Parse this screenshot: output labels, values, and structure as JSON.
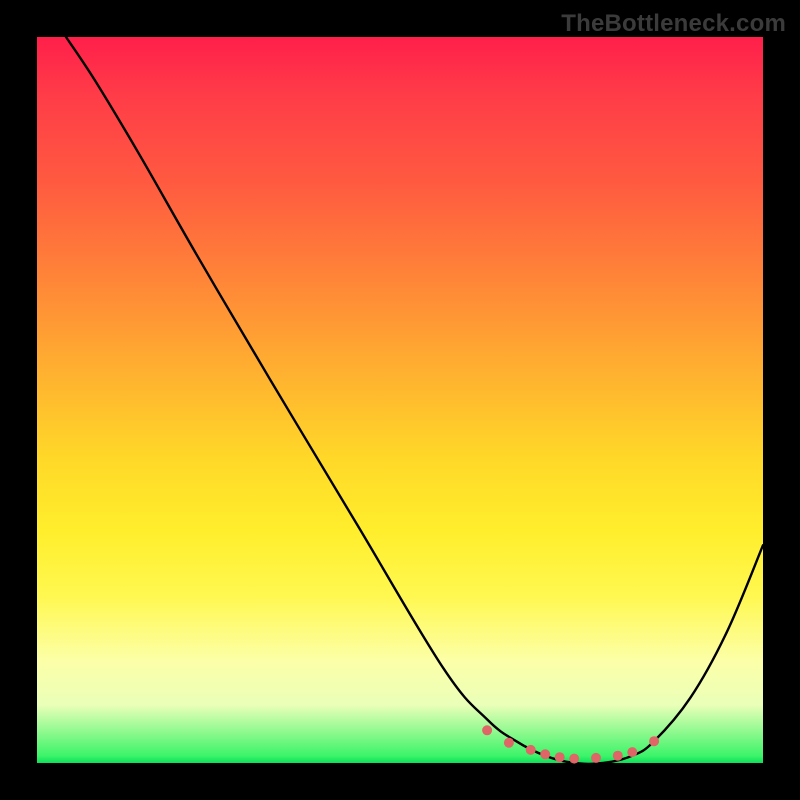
{
  "watermark": "TheBottleneck.com",
  "chart_data": {
    "type": "line",
    "title": "",
    "xlabel": "",
    "ylabel": "",
    "xlim": [
      0,
      100
    ],
    "ylim": [
      0,
      100
    ],
    "grid": false,
    "legend": false,
    "background_gradient": {
      "top": "#ff1f4a",
      "middle": "#ffee2c",
      "bottom": "#0ae058"
    },
    "series": [
      {
        "name": "bottleneck-curve",
        "x": [
          4,
          8,
          14,
          22,
          32,
          44,
          56,
          62,
          66,
          70,
          74,
          78,
          82,
          85,
          90,
          95,
          100
        ],
        "y": [
          100,
          94,
          84,
          70,
          53,
          33,
          13,
          6,
          3,
          1,
          0,
          0,
          1,
          3,
          9,
          18,
          30
        ]
      }
    ],
    "markers": {
      "name": "min-zone-dots",
      "x": [
        62,
        65,
        68,
        70,
        72,
        74,
        77,
        80,
        82,
        85
      ],
      "y": [
        4.5,
        2.8,
        1.8,
        1.2,
        0.8,
        0.6,
        0.7,
        1.0,
        1.5,
        3.0
      ],
      "color": "#de6666"
    }
  }
}
